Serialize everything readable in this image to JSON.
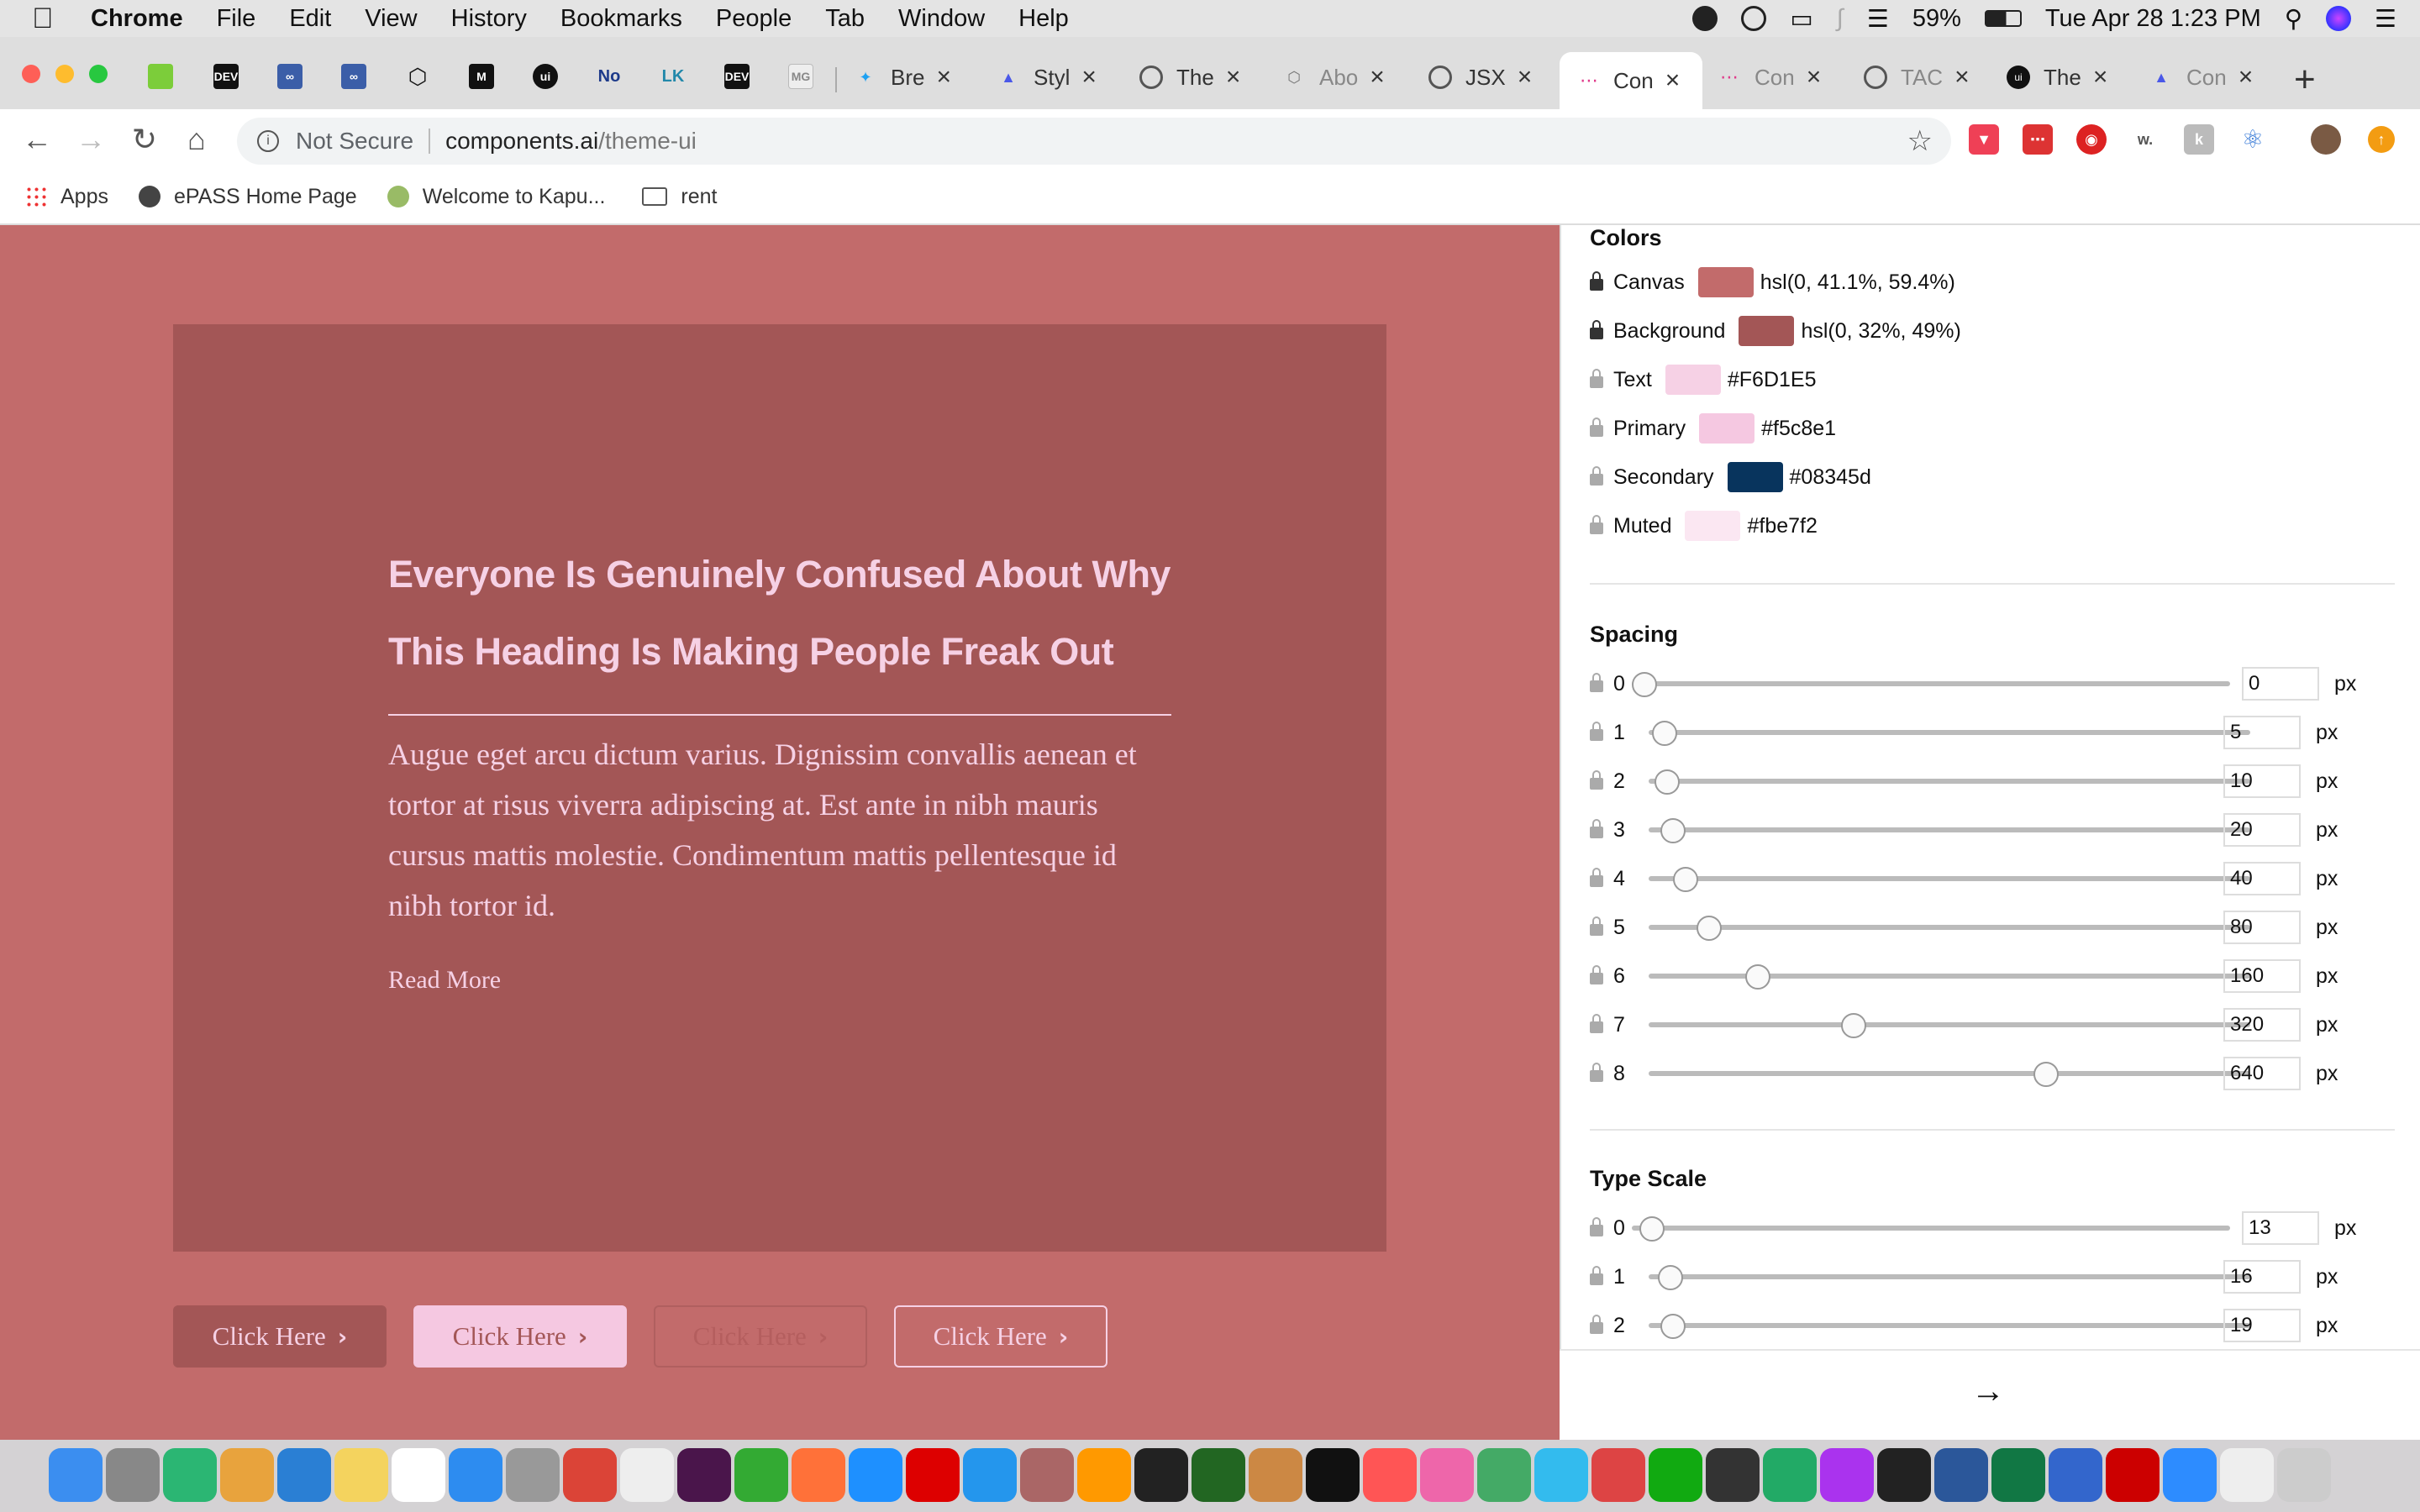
{
  "menubar": {
    "app": "Chrome",
    "items": [
      "File",
      "Edit",
      "View",
      "History",
      "Bookmarks",
      "People",
      "Tab",
      "Window",
      "Help"
    ],
    "battery": "59%",
    "datetime": "Tue Apr 28  1:23 PM"
  },
  "tabs": {
    "pinned": [
      "DEV",
      "M",
      "ui",
      "DEV",
      "MG"
    ],
    "items": [
      {
        "title": "Bre"
      },
      {
        "title": "Styl"
      },
      {
        "title": "The"
      },
      {
        "title": "Abo"
      },
      {
        "title": "JSX"
      },
      {
        "title": "Con"
      },
      {
        "title": "Con"
      },
      {
        "title": "TAC"
      },
      {
        "title": "The"
      },
      {
        "title": "Con"
      }
    ]
  },
  "omnibox": {
    "security": "Not Secure",
    "host": "components.ai",
    "path": "/theme-ui"
  },
  "bookmarks": [
    "Apps",
    "ePASS Home Page",
    "Welcome to Kapu...",
    "rent"
  ],
  "page": {
    "heading": "Everyone Is Genuinely Confused About Why This Heading Is Making People Freak Out",
    "body": "Augue eget arcu dictum varius. Dignissim convallis aenean et tortor at risus viverra adipiscing at. Est ante in nibh mauris cursus mattis molestie. Condimentum mattis pellentesque id nibh tortor id.",
    "read_more": "Read More",
    "buttons": [
      "Click Here",
      "Click Here",
      "Click Here",
      "Click Here"
    ]
  },
  "panel": {
    "colors_title": "Colors",
    "colors": [
      {
        "name": "Canvas",
        "value": "hsl(0, 41.1%, 59.4%)",
        "swatch": "#c26b6b",
        "locked": true
      },
      {
        "name": "Background",
        "value": "hsl(0, 32%, 49%)",
        "swatch": "#a35656",
        "locked": true
      },
      {
        "name": "Text",
        "value": "#F6D1E5",
        "swatch": "#F6D1E5",
        "locked": false
      },
      {
        "name": "Primary",
        "value": "#f5c8e1",
        "swatch": "#f5c8e1",
        "locked": false
      },
      {
        "name": "Secondary",
        "value": "#08345d",
        "swatch": "#08345d",
        "locked": false
      },
      {
        "name": "Muted",
        "value": "#fbe7f2",
        "swatch": "#fbe7f2",
        "locked": false
      }
    ],
    "spacing_title": "Spacing",
    "spacing": [
      {
        "label": "0",
        "value": "0",
        "level": 0
      },
      {
        "label": "1",
        "value": "5",
        "level": 0.005
      },
      {
        "label": "2",
        "value": "10",
        "level": 0.01
      },
      {
        "label": "3",
        "value": "20",
        "level": 0.02
      },
      {
        "label": "4",
        "value": "40",
        "level": 0.04
      },
      {
        "label": "5",
        "value": "80",
        "level": 0.08
      },
      {
        "label": "6",
        "value": "160",
        "level": 0.16
      },
      {
        "label": "7",
        "value": "320",
        "level": 0.32
      },
      {
        "label": "8",
        "value": "640",
        "level": 0.64
      }
    ],
    "type_title": "Type Scale",
    "type_scale": [
      {
        "label": "0",
        "value": "13",
        "level": 0.013
      },
      {
        "label": "1",
        "value": "16",
        "level": 0.016
      },
      {
        "label": "2",
        "value": "19",
        "level": 0.019
      }
    ],
    "unit": "px"
  },
  "colors": {
    "canvas": "#c26b6b",
    "card": "#a35656",
    "text": "#F6D1E5",
    "primary": "#f5c8e1"
  }
}
